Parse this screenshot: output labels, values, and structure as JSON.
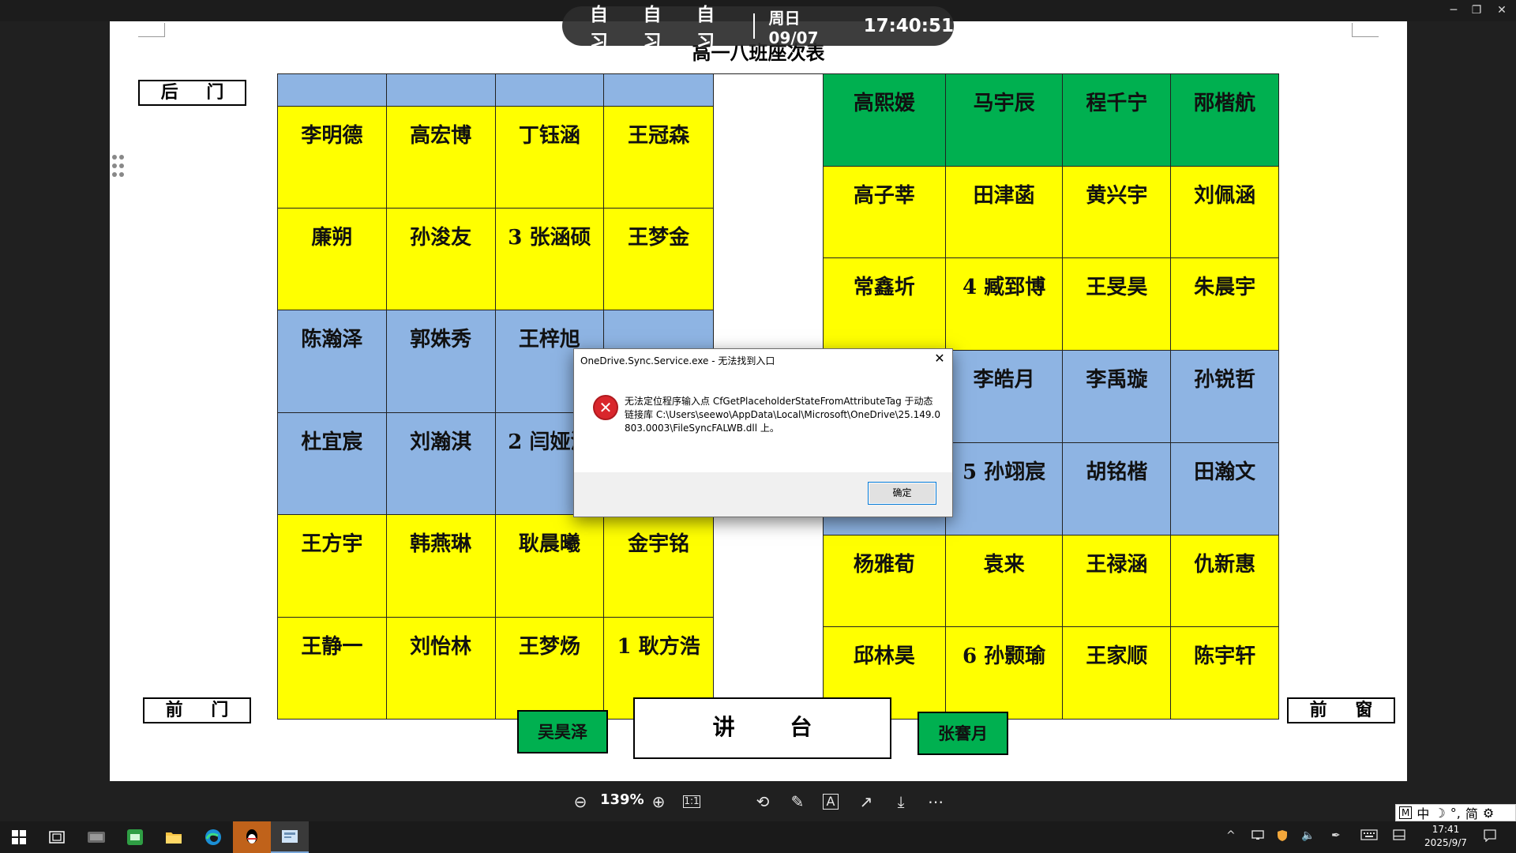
{
  "window": {
    "minimize": "─",
    "restore": "❐",
    "close": "✕"
  },
  "schedule": {
    "classes": [
      "自习",
      "自习",
      "自习"
    ],
    "date": "周日 09/07",
    "time": "17:40:51"
  },
  "document": {
    "title": "高一八班座次表",
    "back_door": "后 门",
    "front_door": "前 门",
    "front_window": "前 窗",
    "podium": "讲 台",
    "left_teacher_desk": "吴昊泽",
    "right_teacher_desk": "张謇月",
    "left_rows": [
      {
        "color": "blue",
        "seats": [
          "",
          "",
          "",
          ""
        ]
      },
      {
        "color": "yellow",
        "seats": [
          "李明德",
          "高宏博",
          "丁钰涵",
          "王冠森"
        ]
      },
      {
        "color": "yellow",
        "seats": [
          "廉朔",
          "孙浚友",
          "3 张涵硕",
          "王梦金"
        ]
      },
      {
        "color": "blue",
        "seats": [
          "陈瀚泽",
          "郭姝秀",
          "王梓旭",
          ""
        ]
      },
      {
        "color": "blue",
        "seats": [
          "杜宜宸",
          "刘瀚淇",
          "2 闫娅涵",
          ""
        ]
      },
      {
        "color": "yellow",
        "seats": [
          "王方宇",
          "韩燕琳",
          "耿晨曦",
          "金宇铭"
        ]
      },
      {
        "color": "yellow",
        "seats": [
          "王静一",
          "刘怡林",
          "王梦炀",
          "1 耿方浩"
        ]
      }
    ],
    "right_rows": [
      {
        "color": "green",
        "seats": [
          "高熙媛",
          "马宇辰",
          "程千宁",
          "邴楷航"
        ]
      },
      {
        "color": "yellow",
        "seats": [
          "高子莘",
          "田津菡",
          "黄兴宇",
          "刘佩涵"
        ]
      },
      {
        "color": "yellow",
        "seats": [
          "常鑫圻",
          "4 臧郅博",
          "王旻昊",
          "朱晨宇"
        ]
      },
      {
        "color": "blue",
        "seats": [
          "",
          "李皓月",
          "李禹璇",
          "孙锐哲"
        ]
      },
      {
        "color": "blue",
        "seats": [
          "",
          "5 孙翊宸",
          "胡铭楷",
          "田瀚文"
        ]
      },
      {
        "color": "yellow",
        "seats": [
          "杨雅荀",
          "袁来",
          "王禄涵",
          "仇新惠"
        ]
      },
      {
        "color": "yellow",
        "seats": [
          "邱林昊",
          "6 孙颢瑜",
          "王家顺",
          "陈宇轩"
        ]
      }
    ]
  },
  "toolbar": {
    "zoom_out": "⊖",
    "zoom": "139%",
    "zoom_in": "⊕",
    "actual_size": "1:1",
    "rotate": "⟲",
    "edit": "✎",
    "ocr": "A",
    "share": "↗",
    "download": "⤓",
    "more": "⋯"
  },
  "dialog": {
    "title": "OneDrive.Sync.Service.exe - 无法找到入口",
    "message": "无法定位程序输入点 CfGetPlaceholderStateFromAttributeTag 于动态链接库 C:\\Users\\seewo\\AppData\\Local\\Microsoft\\OneDrive\\25.149.0803.0003\\FileSyncFALWB.dll 上。",
    "ok_label": "确定",
    "close": "✕"
  },
  "ime": {
    "mode": "中",
    "mark1": "M",
    "punct": "°,",
    "simplified": "简",
    "settings": "⚙"
  },
  "taskbar": {
    "clock_time": "17:41",
    "clock_date": "2025/9/7"
  },
  "colors": {
    "blue": "#8eb4e3",
    "yellow": "#ffff00",
    "green": "#00b050"
  }
}
